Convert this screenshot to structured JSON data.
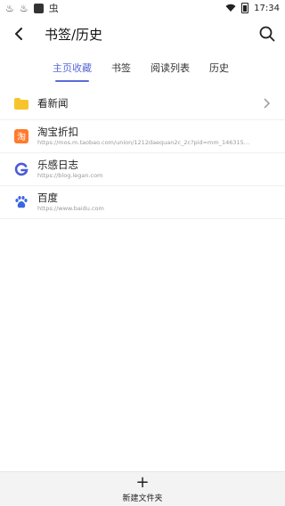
{
  "status_bar": {
    "time": "17:34"
  },
  "header": {
    "title": "书签/历史"
  },
  "tabs": [
    {
      "label": "主页收藏",
      "active": true
    },
    {
      "label": "书签",
      "active": false
    },
    {
      "label": "阅读列表",
      "active": false
    },
    {
      "label": "历史",
      "active": false
    }
  ],
  "items": [
    {
      "type": "folder",
      "name": "看新闻",
      "icon": "folder-icon"
    },
    {
      "type": "site",
      "name": "淘宝折扣",
      "url": "https://mos.m.taobao.com/union/1212daequan2c_2c?pid=mm_14631535_25...",
      "icon": "taobao-icon"
    },
    {
      "type": "site",
      "name": "乐感日志",
      "url": "https://blog.legan.com",
      "icon": "legan-icon"
    },
    {
      "type": "site",
      "name": "百度",
      "url": "https://www.baidu.com",
      "icon": "baidu-icon"
    }
  ],
  "bottom_bar": {
    "new_folder_label": "新建文件夹"
  },
  "colors": {
    "accent": "#5b6ad8",
    "folder": "#f7c52b",
    "taobao": "#ff7a2b",
    "baidu": "#3a66e0"
  }
}
